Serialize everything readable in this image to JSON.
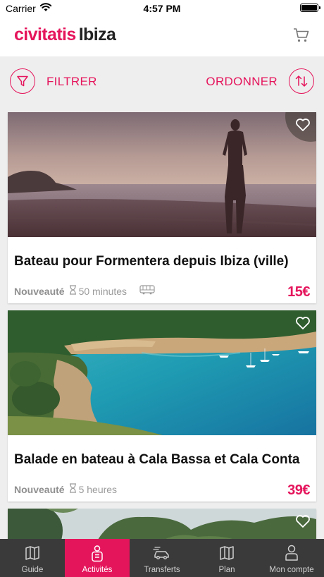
{
  "status_bar": {
    "carrier": "Carrier",
    "time": "4:57 PM"
  },
  "header": {
    "brand": "civitatis",
    "city": "Ibiza",
    "cart_icon": "cart-icon"
  },
  "toolbar": {
    "filter_label": "FILTRER",
    "sort_label": "ORDONNER"
  },
  "colors": {
    "accent": "#e5155c",
    "tabbar": "#3a3a3a",
    "background": "#eeeeee"
  },
  "activities": [
    {
      "title": "Bateau pour Formentera depuis Ibiza (ville)",
      "badge": "Nouveauté",
      "duration": "50 minutes",
      "transport_icon": "bus-icon",
      "price": "15€"
    },
    {
      "title": "Balade en bateau à Cala Bassa et Cala Conta",
      "badge": "Nouveauté",
      "duration": "5 heures",
      "price": "39€"
    }
  ],
  "tabs": [
    {
      "label": "Guide",
      "icon": "map-book-icon",
      "active": false
    },
    {
      "label": "Activités",
      "icon": "activities-icon",
      "active": true
    },
    {
      "label": "Transferts",
      "icon": "transfer-car-icon",
      "active": false
    },
    {
      "label": "Plan",
      "icon": "map-icon",
      "active": false
    },
    {
      "label": "Mon compte",
      "icon": "user-icon",
      "active": false
    }
  ]
}
